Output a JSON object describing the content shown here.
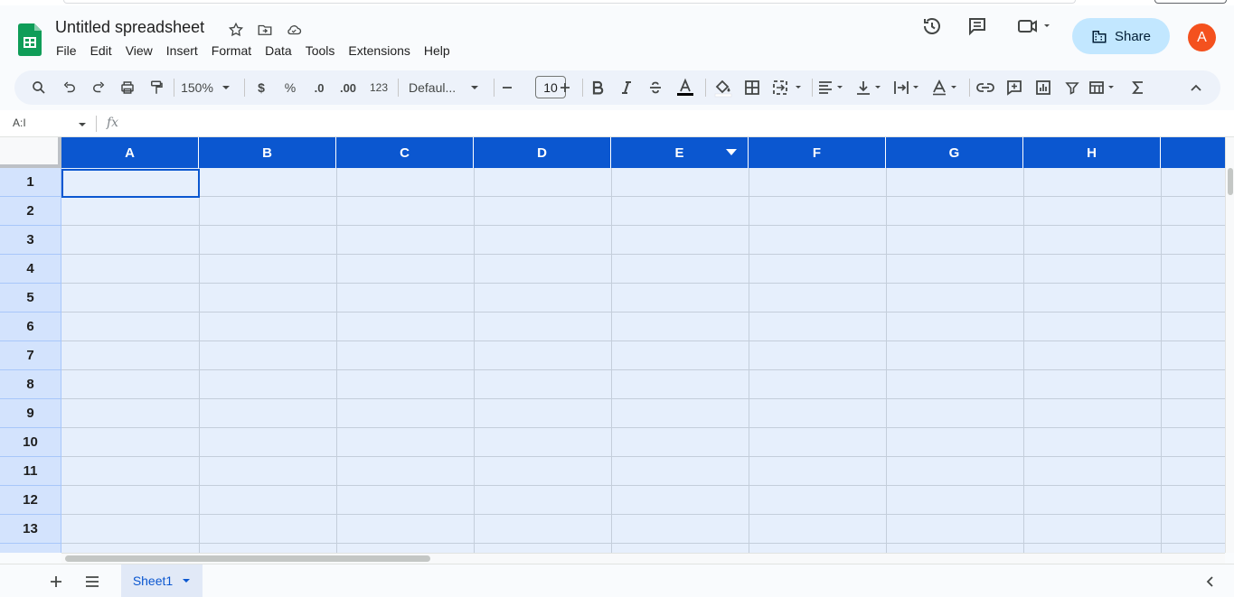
{
  "doc": {
    "title": "Untitled spreadsheet"
  },
  "menu": [
    "File",
    "Edit",
    "View",
    "Insert",
    "Format",
    "Data",
    "Tools",
    "Extensions",
    "Help"
  ],
  "header": {
    "share_label": "Share",
    "avatar_letter": "A"
  },
  "toolbar": {
    "zoom": "150%",
    "currency": "$",
    "percent": "%",
    "dec_decrease": ".0",
    "dec_increase": ".00",
    "format_more": "123",
    "font": "Defaul...",
    "font_size": "10"
  },
  "formula_bar": {
    "name_box": "A:I",
    "fx": "fx"
  },
  "columns": [
    "A",
    "B",
    "C",
    "D",
    "E",
    "F",
    "G",
    "H"
  ],
  "rows": [
    "1",
    "2",
    "3",
    "4",
    "5",
    "6",
    "7",
    "8",
    "9",
    "10",
    "11",
    "12",
    "13"
  ],
  "sheets": [
    {
      "name": "Sheet1"
    }
  ],
  "colors": {
    "accent": "#0b57d0",
    "selection_fill": "#e6effc",
    "share_bg": "#c2e7ff",
    "avatar": "#f4511e"
  }
}
